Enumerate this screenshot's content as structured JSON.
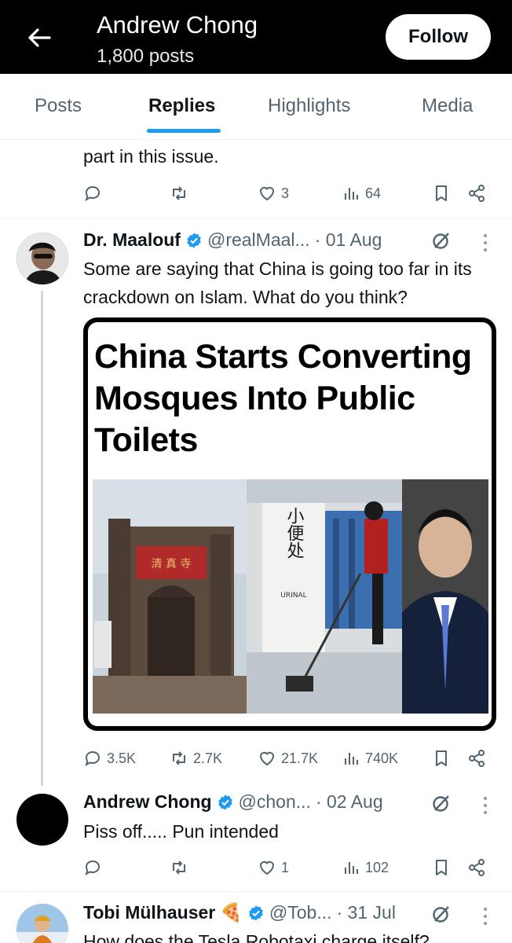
{
  "header": {
    "name": "Andrew Chong",
    "post_count": "1,800 posts",
    "follow_label": "Follow"
  },
  "tabs": [
    {
      "label": "Posts",
      "active": false
    },
    {
      "label": "Replies",
      "active": true
    },
    {
      "label": "Highlights",
      "active": false
    },
    {
      "label": "Media",
      "active": false
    }
  ],
  "prev_tweet": {
    "text_tail": "part in this issue.",
    "actions": {
      "replies": "",
      "reposts": "",
      "likes": "3",
      "views": "64"
    }
  },
  "tweets": [
    {
      "name": "Dr. Maalouf",
      "handle": "@realMaal...",
      "date": "· 01 Aug",
      "body": "Some are saying that China is going too far in its crackdown on Islam. What do you think?",
      "media": {
        "headline": "China Starts Converting Mosques Into Public Toilets",
        "sign_text": "小便处",
        "sign_caption": "URINAL"
      },
      "actions": {
        "replies": "3.5K",
        "reposts": "2.7K",
        "likes": "21.7K",
        "views": "740K"
      }
    },
    {
      "name": "Andrew Chong",
      "handle": "@chon...",
      "date": "· 02 Aug",
      "body": "Piss off..... Pun intended",
      "actions": {
        "replies": "",
        "reposts": "",
        "likes": "1",
        "views": "102"
      }
    },
    {
      "name": "Tobi Mülhauser",
      "name_emoji": "🍕",
      "handle": "@Tob...",
      "date": "· 31 Jul",
      "body": "How does the Tesla Robotaxi charge itself?"
    }
  ],
  "colors": {
    "accent": "#1d9bf0",
    "muted_text": "#536471",
    "header_bg": "#000000"
  },
  "icons": [
    "back-arrow-icon",
    "reply-icon",
    "repost-icon",
    "like-icon",
    "views-icon",
    "bookmark-icon",
    "share-icon",
    "verified-icon",
    "grok-icon",
    "more-icon"
  ]
}
